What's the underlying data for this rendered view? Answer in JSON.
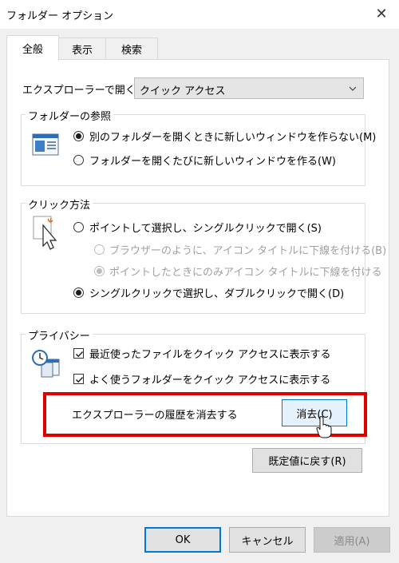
{
  "window": {
    "title": "フォルダー オプション",
    "close_glyph": "✕"
  },
  "tabs": [
    {
      "label": "全般",
      "active": true
    },
    {
      "label": "表示",
      "active": false
    },
    {
      "label": "検索",
      "active": false
    }
  ],
  "open_explorer": {
    "label": "エクスプローラーで開く:",
    "value": "クイック アクセス"
  },
  "browse_folders": {
    "title": "フォルダーの参照",
    "options": [
      {
        "label": "別のフォルダーを開くときに新しいウィンドウを作らない(M)",
        "selected": true
      },
      {
        "label": "フォルダーを開くたびに新しいウィンドウを作る(W)",
        "selected": false
      }
    ]
  },
  "click_method": {
    "title": "クリック方法",
    "options": [
      {
        "label": "ポイントして選択し、シングルクリックで開く(S)",
        "selected": false,
        "enabled": true
      },
      {
        "label": "ブラウザーのように、アイコン タイトルに下線を付ける(B)",
        "selected": false,
        "enabled": false
      },
      {
        "label": "ポイントしたときにのみアイコン タイトルに下線を付ける",
        "selected": true,
        "enabled": false
      },
      {
        "label": "シングルクリックで選択し、ダブルクリックで開く(D)",
        "selected": true,
        "enabled": true
      }
    ]
  },
  "privacy": {
    "title": "プライバシー",
    "checks": [
      {
        "label": "最近使ったファイルをクイック アクセスに表示する",
        "checked": true
      },
      {
        "label": "よく使うフォルダーをクイック アクセスに表示する",
        "checked": true
      }
    ],
    "clear_label": "エクスプローラーの履歴を消去する",
    "clear_button": "消去(C)"
  },
  "restore_button": "既定値に戻す(R)",
  "footer": {
    "ok": "OK",
    "cancel": "キャンセル",
    "apply": "適用(A)"
  },
  "colors": {
    "highlight_box": "#e00000",
    "focus_border": "#0078d7"
  }
}
